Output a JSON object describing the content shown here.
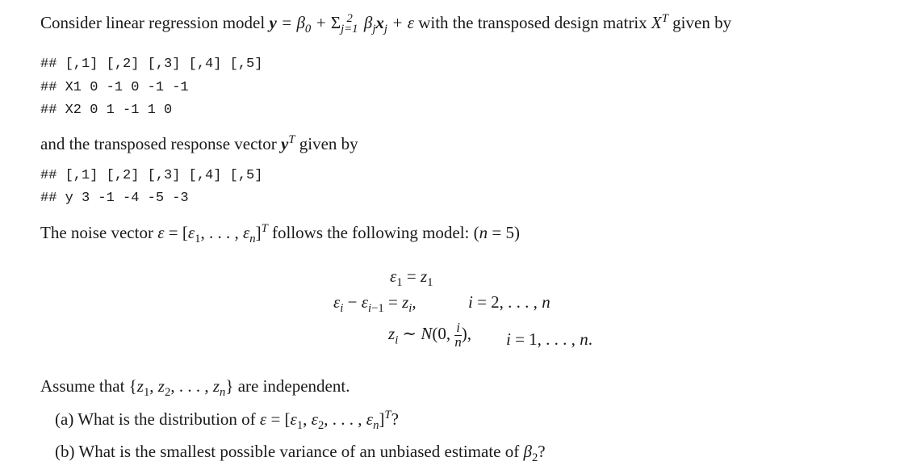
{
  "intro": {
    "text_before": "Consider linear regression model ",
    "model": "y = β₀ + Σ_{j=1}^{2} β_j x_j + ε",
    "text_after": " with the transposed design matrix ",
    "matrix_symbol": "Xᵀ",
    "text_end": " given by"
  },
  "design_matrix": {
    "header": "##     [,1] [,2] [,3] [,4] [,5]",
    "rows": [
      "## X1     0   -1    0   -1   -1",
      "## X2     0    1   -1    1    0"
    ]
  },
  "response_intro": {
    "text": "and the transposed response vector ",
    "symbol": "yᵀ",
    "text_end": " given by"
  },
  "response_vector": {
    "header": "##    [,1] [,2] [,3] [,4] [,5]",
    "row": "## y     3   -1   -4   -5   -3"
  },
  "noise": {
    "text_before": "The noise vector ",
    "vector": "ε = [ε₁, . . . , εₙ]ᵀ",
    "text_after": " follows the following model: ",
    "n_value": "(n = 5)"
  },
  "equations": {
    "eq1": "ε₁ = z₁",
    "eq2_lhs": "εᵢ − εᵢ₋₁ = zᵢ,",
    "eq2_range": "i = 2, . . . , n",
    "eq3_lhs": "zᵢ ∼ N(0,",
    "eq3_num": "i",
    "eq3_den": "n",
    "eq3_close": "),",
    "eq3_range": "i = 1, . . . , n."
  },
  "assumption": {
    "text": "Assume that ",
    "set": "{z₁, z₂, . . . , zₙ}",
    "text_end": " are independent."
  },
  "questions": [
    {
      "label": "(a)",
      "text": "What is the distribution of ",
      "math": "ε = [ε₁, ε₂, . . . , εₙ]ᵀ",
      "end": "?"
    },
    {
      "label": "(b)",
      "text": "What is the smallest possible variance of an unbiased estimate of ",
      "math": "β₂",
      "end": "?"
    }
  ]
}
